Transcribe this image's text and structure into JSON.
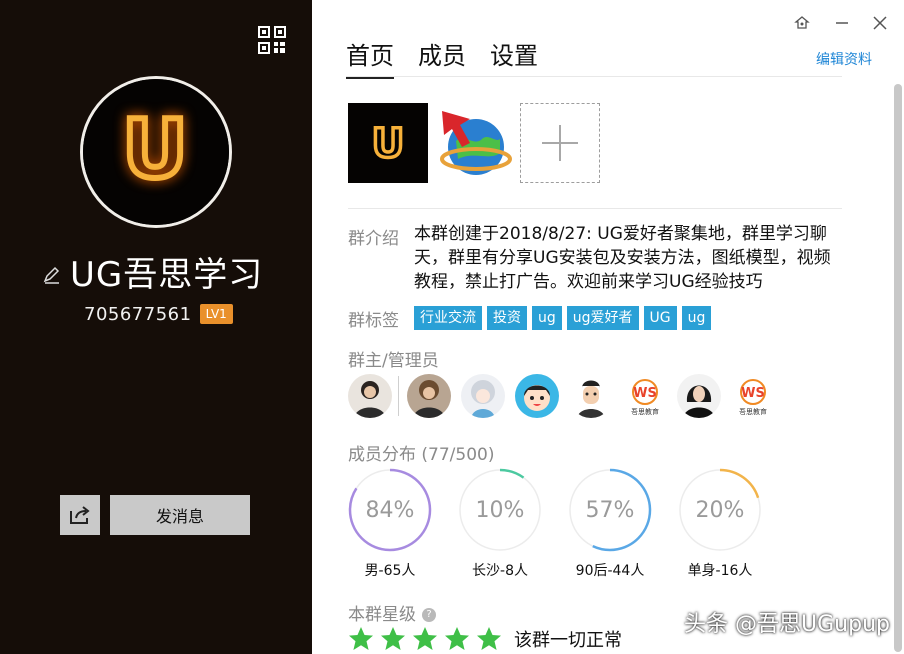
{
  "left_panel": {
    "group_name": "UG吾思学习",
    "group_id": "705677561",
    "level_badge": "LV1",
    "send_message_label": "发消息",
    "avatar_letter": "U",
    "background_color": "#150d08"
  },
  "tabs": [
    "首页",
    "成员",
    "设置"
  ],
  "edit_profile_label": "编辑资料",
  "intro": {
    "label": "群介绍",
    "text": "本群创建于2018/8/27: UG爱好者聚集地，群里学习聊天，群里有分享UG安装包及安装方法，图纸模型，视频教程，禁止打广告。欢迎前来学习UG经验技巧"
  },
  "tags_section": {
    "label": "群标签",
    "tags": [
      "行业交流",
      "投资",
      "ug",
      "ug爱好者",
      "UG",
      "ug"
    ],
    "tag_color": "#2aa0d6"
  },
  "admins_section": {
    "label": "群主/管理员",
    "admin_icon_names": [
      "avatar-owner",
      "avatar-admin-1",
      "avatar-admin-2",
      "avatar-admin-3",
      "avatar-admin-4",
      "avatar-admin-ws-1",
      "avatar-admin-5",
      "avatar-admin-ws-2"
    ],
    "ws_logo_text": "WS",
    "ws_logo_subtext": "吾思教育"
  },
  "distribution": {
    "label": "成员分布 (77/500)",
    "stats": [
      {
        "percent_text": "84%",
        "fraction": 0.84,
        "label": "男-65人",
        "color": "#a78be0"
      },
      {
        "percent_text": "10%",
        "fraction": 0.1,
        "label": "长沙-8人",
        "color": "#4cc9a0"
      },
      {
        "percent_text": "57%",
        "fraction": 0.57,
        "label": "90后-44人",
        "color": "#5aa8e6"
      },
      {
        "percent_text": "20%",
        "fraction": 0.2,
        "label": "单身-16人",
        "color": "#f2b44b"
      }
    ]
  },
  "rating": {
    "label": "本群星级",
    "stars": 5,
    "status_text": "该群一切正常",
    "star_color": "#3fbf47"
  },
  "watermark": "头条 @吾思UGupup"
}
